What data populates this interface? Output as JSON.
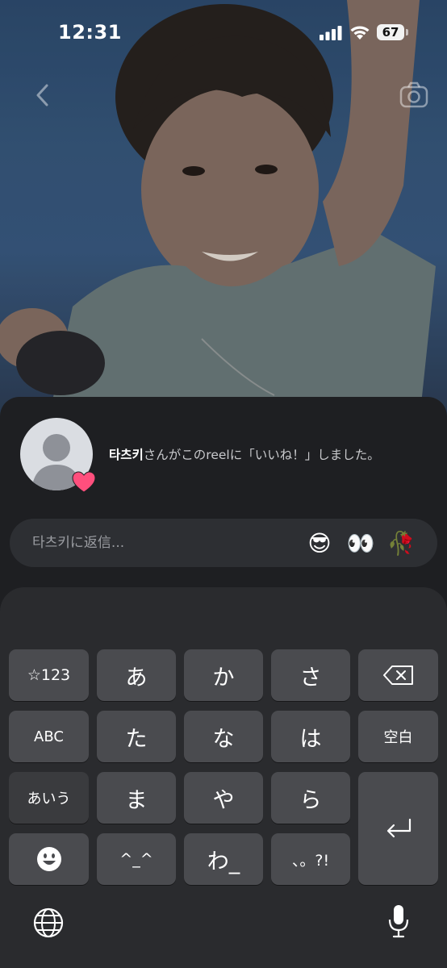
{
  "status": {
    "time": "12:31",
    "battery": "67"
  },
  "notification": {
    "username": "타츠키",
    "message": "さんがこのreelに「いいね！」しました。"
  },
  "reply": {
    "placeholder": "타츠키に返信...",
    "quick_reactions": [
      "😎",
      "👀",
      "🥀"
    ]
  },
  "keyboard": {
    "row1": [
      "☆123",
      "あ",
      "か",
      "さ"
    ],
    "row2": [
      "ABC",
      "た",
      "な",
      "は",
      "空白"
    ],
    "row3": [
      "あいう",
      "ま",
      "や",
      "ら"
    ],
    "row4": [
      "^_^",
      "わ_",
      "、。?!"
    ]
  },
  "colors": {
    "like_heart": "#ff4f7d",
    "sheet": "#1e1f22",
    "key": "#4a4b4f"
  }
}
